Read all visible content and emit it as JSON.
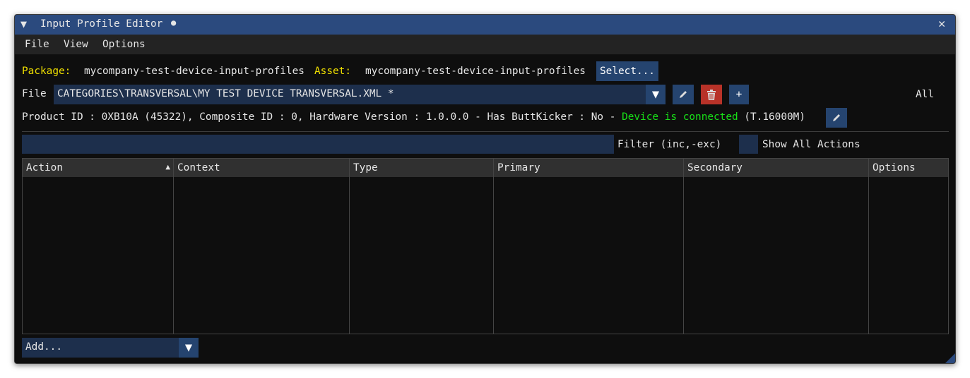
{
  "window": {
    "title": "Input Profile Editor",
    "modified_dot": "●",
    "close": "✕"
  },
  "menu": [
    "File",
    "View",
    "Options"
  ],
  "package": {
    "label": "Package:",
    "value": "mycompany-test-device-input-profiles",
    "asset_label": "Asset:",
    "asset_value": "mycompany-test-device-input-profiles",
    "select_button": "Select..."
  },
  "file": {
    "label": "File",
    "value": "CATEGORIES\\TRANSVERSAL\\MY TEST DEVICE TRANSVERSAL.XML *",
    "all_label": "All",
    "add_symbol": "+"
  },
  "device": {
    "info": "Product ID : 0XB10A (45322), Composite ID : 0, Hardware Version : 1.0.0.0 - Has ButtKicker : No - ",
    "status": "Device is connected",
    "model": "(T.16000M)",
    "status_color": "#18e018"
  },
  "filter": {
    "value": "",
    "label": "Filter (inc,-exc)",
    "show_all_label": "Show All Actions",
    "show_all_checked": false
  },
  "table": {
    "columns": [
      "Action",
      "Context",
      "Type",
      "Primary",
      "Secondary",
      "Options"
    ],
    "sort_indicator": "▲",
    "rows": []
  },
  "add": {
    "label": "Add..."
  }
}
